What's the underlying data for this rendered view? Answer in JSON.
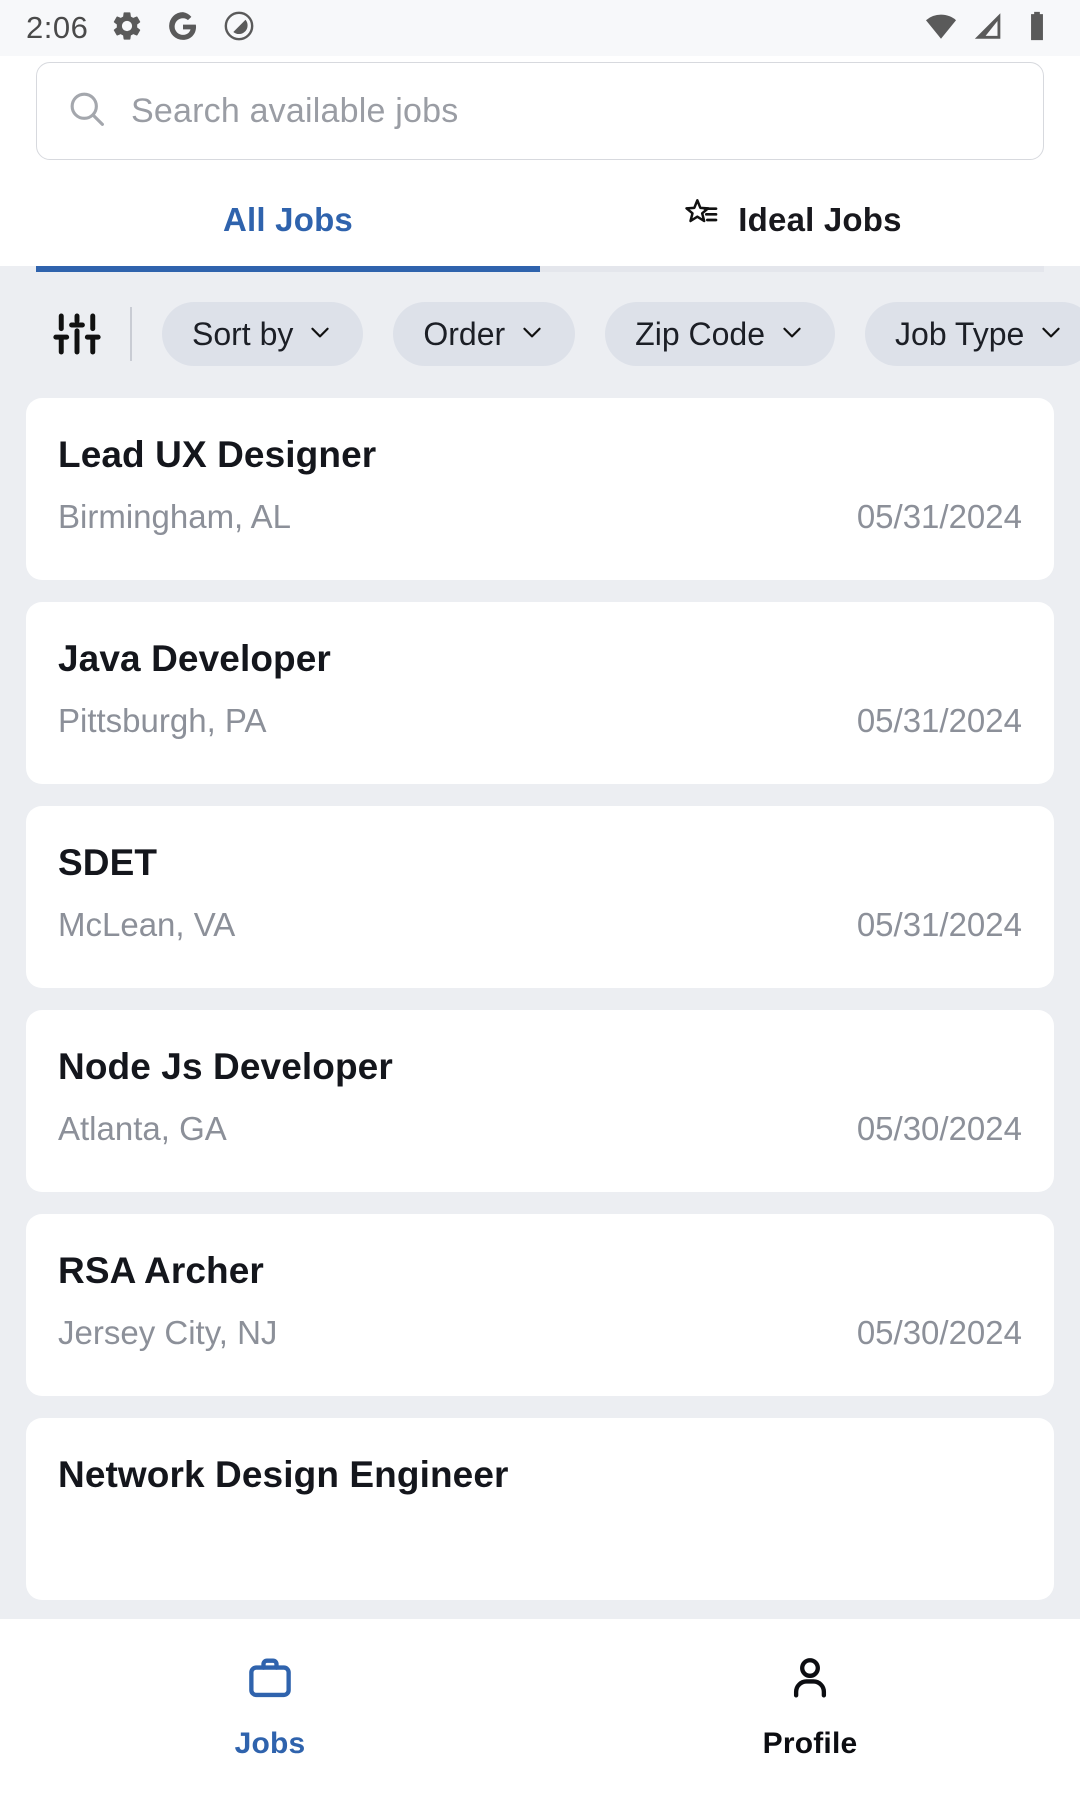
{
  "status_bar": {
    "time": "2:06",
    "left_icons": [
      "gear-icon",
      "google-g-icon",
      "adblock-icon"
    ],
    "right_icons": [
      "wifi-icon",
      "cellular-signal-icon",
      "battery-icon"
    ]
  },
  "search": {
    "placeholder": "Search available jobs",
    "value": "",
    "icon": "search-icon"
  },
  "tabs": [
    {
      "label": "All Jobs",
      "active": true,
      "icon": null
    },
    {
      "label": "Ideal Jobs",
      "active": false,
      "icon": "star-list-icon"
    }
  ],
  "filters": {
    "tune_icon": "tune-sliders-icon",
    "chips": [
      {
        "label": "Sort by",
        "icon": "chevron-down-icon"
      },
      {
        "label": "Order",
        "icon": "chevron-down-icon"
      },
      {
        "label": "Zip Code",
        "icon": "chevron-down-icon"
      },
      {
        "label": "Job Type",
        "icon": "chevron-down-icon"
      }
    ]
  },
  "jobs": [
    {
      "title": "Lead UX Designer",
      "location": "Birmingham, AL",
      "date": "05/31/2024"
    },
    {
      "title": "Java Developer",
      "location": "Pittsburgh, PA",
      "date": "05/31/2024"
    },
    {
      "title": "SDET",
      "location": "McLean, VA",
      "date": "05/31/2024"
    },
    {
      "title": "Node Js Developer",
      "location": "Atlanta, GA",
      "date": "05/30/2024"
    },
    {
      "title": "RSA Archer",
      "location": "Jersey City, NJ",
      "date": "05/30/2024"
    },
    {
      "title": "Network Design Engineer",
      "location": "",
      "date": ""
    }
  ],
  "bottom_nav": [
    {
      "label": "Jobs",
      "icon": "briefcase-icon",
      "active": true
    },
    {
      "label": "Profile",
      "icon": "person-icon",
      "active": false
    }
  ],
  "colors": {
    "accent": "#2f63ad",
    "page_bg": "#eceef2",
    "card_bg": "#ffffff",
    "muted_text": "#8c9099",
    "chip_bg": "#dde1e9"
  }
}
